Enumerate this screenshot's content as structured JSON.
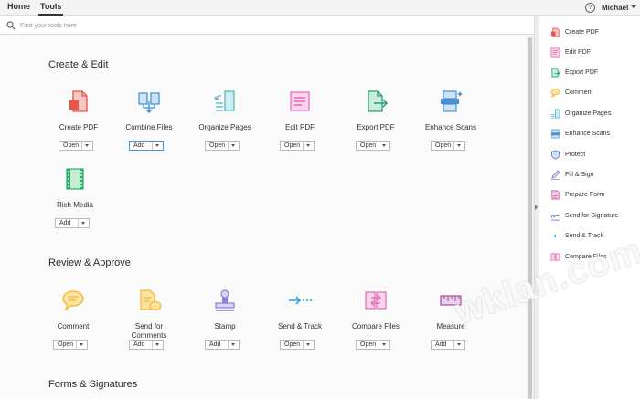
{
  "topbar": {
    "tabs": [
      {
        "label": "Home"
      },
      {
        "label": "Tools"
      }
    ],
    "help_glyph": "?",
    "user_name": "Michael"
  },
  "search": {
    "placeholder": "Find your tools here"
  },
  "sections": [
    {
      "title": "Create & Edit",
      "tools": [
        {
          "label": "Create PDF",
          "button": "Open",
          "icon": "create-pdf-icon",
          "color": "#e8534a"
        },
        {
          "label": "Combine Files",
          "button": "Add",
          "icon": "combine-files-icon",
          "color": "#3d8fd1",
          "highlight": true
        },
        {
          "label": "Organize Pages",
          "button": "Open",
          "icon": "organize-pages-icon",
          "color": "#4fb3bf"
        },
        {
          "label": "Edit PDF",
          "button": "Open",
          "icon": "edit-pdf-icon",
          "color": "#e069b7"
        },
        {
          "label": "Export PDF",
          "button": "Open",
          "icon": "export-pdf-icon",
          "color": "#2aa174"
        },
        {
          "label": "Enhance Scans",
          "button": "Open",
          "icon": "enhance-scans-icon",
          "color": "#4a8fd6"
        },
        {
          "label": "Rich Media",
          "button": "Add",
          "icon": "rich-media-icon",
          "color": "#2fae6b"
        }
      ]
    },
    {
      "title": "Review & Approve",
      "tools": [
        {
          "label": "Comment",
          "button": "Open",
          "icon": "comment-icon",
          "color": "#f2b92a"
        },
        {
          "label": "Send for Comments",
          "button": "Add",
          "icon": "send-for-comments-icon",
          "color": "#f2b92a"
        },
        {
          "label": "Stamp",
          "button": "Add",
          "icon": "stamp-icon",
          "color": "#8a7fd3"
        },
        {
          "label": "Send & Track",
          "button": "Open",
          "icon": "send-track-icon",
          "color": "#2a9fd6"
        },
        {
          "label": "Compare Files",
          "button": "Open",
          "icon": "compare-files-icon",
          "color": "#e069b7"
        },
        {
          "label": "Measure",
          "button": "Add",
          "icon": "measure-icon",
          "color": "#a3539f"
        }
      ]
    },
    {
      "title": "Forms & Signatures"
    }
  ],
  "right_panel": [
    {
      "label": "Create PDF",
      "icon": "create-pdf-icon",
      "color": "#e8534a"
    },
    {
      "label": "Edit PDF",
      "icon": "edit-pdf-icon",
      "color": "#e069b7"
    },
    {
      "label": "Export PDF",
      "icon": "export-pdf-icon",
      "color": "#2aa174"
    },
    {
      "label": "Comment",
      "icon": "comment-icon",
      "color": "#f2b92a"
    },
    {
      "label": "Organize Pages",
      "icon": "organize-pages-icon",
      "color": "#4fb3bf"
    },
    {
      "label": "Enhance Scans",
      "icon": "enhance-scans-icon",
      "color": "#4a8fd6"
    },
    {
      "label": "Protect",
      "icon": "protect-icon",
      "color": "#4a7bd6"
    },
    {
      "label": "Fill & Sign",
      "icon": "fill-sign-icon",
      "color": "#8a7fd3"
    },
    {
      "label": "Prepare Form",
      "icon": "prepare-form-icon",
      "color": "#c64fa3"
    },
    {
      "label": "Send for Signature",
      "icon": "send-for-signature-icon",
      "color": "#4a7bd6"
    },
    {
      "label": "Send & Track",
      "icon": "send-track-icon",
      "color": "#2a9fd6"
    },
    {
      "label": "Compare Files",
      "icon": "compare-files-icon",
      "color": "#e069b7"
    }
  ],
  "watermark": "wklan.com"
}
